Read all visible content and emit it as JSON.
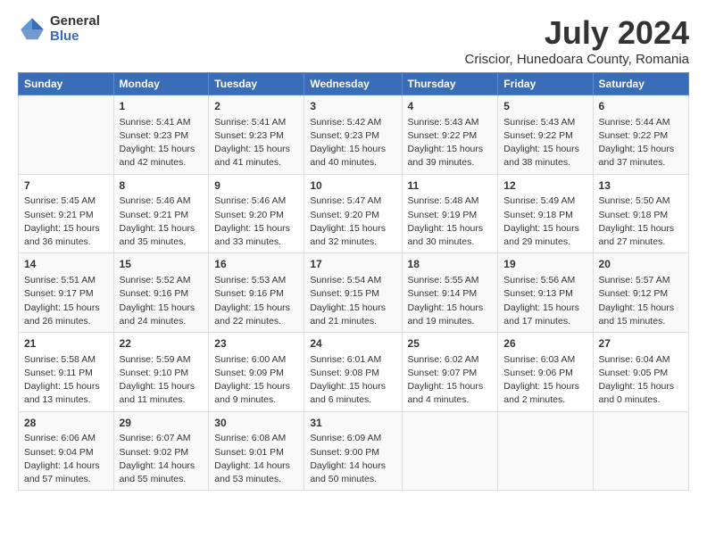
{
  "header": {
    "logo_line1": "General",
    "logo_line2": "Blue",
    "title": "July 2024",
    "subtitle": "Criscior, Hunedoara County, Romania"
  },
  "calendar": {
    "days_of_week": [
      "Sunday",
      "Monday",
      "Tuesday",
      "Wednesday",
      "Thursday",
      "Friday",
      "Saturday"
    ],
    "weeks": [
      [
        {
          "day": "",
          "content": ""
        },
        {
          "day": "1",
          "content": "Sunrise: 5:41 AM\nSunset: 9:23 PM\nDaylight: 15 hours\nand 42 minutes."
        },
        {
          "day": "2",
          "content": "Sunrise: 5:41 AM\nSunset: 9:23 PM\nDaylight: 15 hours\nand 41 minutes."
        },
        {
          "day": "3",
          "content": "Sunrise: 5:42 AM\nSunset: 9:23 PM\nDaylight: 15 hours\nand 40 minutes."
        },
        {
          "day": "4",
          "content": "Sunrise: 5:43 AM\nSunset: 9:22 PM\nDaylight: 15 hours\nand 39 minutes."
        },
        {
          "day": "5",
          "content": "Sunrise: 5:43 AM\nSunset: 9:22 PM\nDaylight: 15 hours\nand 38 minutes."
        },
        {
          "day": "6",
          "content": "Sunrise: 5:44 AM\nSunset: 9:22 PM\nDaylight: 15 hours\nand 37 minutes."
        }
      ],
      [
        {
          "day": "7",
          "content": "Sunrise: 5:45 AM\nSunset: 9:21 PM\nDaylight: 15 hours\nand 36 minutes."
        },
        {
          "day": "8",
          "content": "Sunrise: 5:46 AM\nSunset: 9:21 PM\nDaylight: 15 hours\nand 35 minutes."
        },
        {
          "day": "9",
          "content": "Sunrise: 5:46 AM\nSunset: 9:20 PM\nDaylight: 15 hours\nand 33 minutes."
        },
        {
          "day": "10",
          "content": "Sunrise: 5:47 AM\nSunset: 9:20 PM\nDaylight: 15 hours\nand 32 minutes."
        },
        {
          "day": "11",
          "content": "Sunrise: 5:48 AM\nSunset: 9:19 PM\nDaylight: 15 hours\nand 30 minutes."
        },
        {
          "day": "12",
          "content": "Sunrise: 5:49 AM\nSunset: 9:18 PM\nDaylight: 15 hours\nand 29 minutes."
        },
        {
          "day": "13",
          "content": "Sunrise: 5:50 AM\nSunset: 9:18 PM\nDaylight: 15 hours\nand 27 minutes."
        }
      ],
      [
        {
          "day": "14",
          "content": "Sunrise: 5:51 AM\nSunset: 9:17 PM\nDaylight: 15 hours\nand 26 minutes."
        },
        {
          "day": "15",
          "content": "Sunrise: 5:52 AM\nSunset: 9:16 PM\nDaylight: 15 hours\nand 24 minutes."
        },
        {
          "day": "16",
          "content": "Sunrise: 5:53 AM\nSunset: 9:16 PM\nDaylight: 15 hours\nand 22 minutes."
        },
        {
          "day": "17",
          "content": "Sunrise: 5:54 AM\nSunset: 9:15 PM\nDaylight: 15 hours\nand 21 minutes."
        },
        {
          "day": "18",
          "content": "Sunrise: 5:55 AM\nSunset: 9:14 PM\nDaylight: 15 hours\nand 19 minutes."
        },
        {
          "day": "19",
          "content": "Sunrise: 5:56 AM\nSunset: 9:13 PM\nDaylight: 15 hours\nand 17 minutes."
        },
        {
          "day": "20",
          "content": "Sunrise: 5:57 AM\nSunset: 9:12 PM\nDaylight: 15 hours\nand 15 minutes."
        }
      ],
      [
        {
          "day": "21",
          "content": "Sunrise: 5:58 AM\nSunset: 9:11 PM\nDaylight: 15 hours\nand 13 minutes."
        },
        {
          "day": "22",
          "content": "Sunrise: 5:59 AM\nSunset: 9:10 PM\nDaylight: 15 hours\nand 11 minutes."
        },
        {
          "day": "23",
          "content": "Sunrise: 6:00 AM\nSunset: 9:09 PM\nDaylight: 15 hours\nand 9 minutes."
        },
        {
          "day": "24",
          "content": "Sunrise: 6:01 AM\nSunset: 9:08 PM\nDaylight: 15 hours\nand 6 minutes."
        },
        {
          "day": "25",
          "content": "Sunrise: 6:02 AM\nSunset: 9:07 PM\nDaylight: 15 hours\nand 4 minutes."
        },
        {
          "day": "26",
          "content": "Sunrise: 6:03 AM\nSunset: 9:06 PM\nDaylight: 15 hours\nand 2 minutes."
        },
        {
          "day": "27",
          "content": "Sunrise: 6:04 AM\nSunset: 9:05 PM\nDaylight: 15 hours\nand 0 minutes."
        }
      ],
      [
        {
          "day": "28",
          "content": "Sunrise: 6:06 AM\nSunset: 9:04 PM\nDaylight: 14 hours\nand 57 minutes."
        },
        {
          "day": "29",
          "content": "Sunrise: 6:07 AM\nSunset: 9:02 PM\nDaylight: 14 hours\nand 55 minutes."
        },
        {
          "day": "30",
          "content": "Sunrise: 6:08 AM\nSunset: 9:01 PM\nDaylight: 14 hours\nand 53 minutes."
        },
        {
          "day": "31",
          "content": "Sunrise: 6:09 AM\nSunset: 9:00 PM\nDaylight: 14 hours\nand 50 minutes."
        },
        {
          "day": "",
          "content": ""
        },
        {
          "day": "",
          "content": ""
        },
        {
          "day": "",
          "content": ""
        }
      ]
    ]
  }
}
